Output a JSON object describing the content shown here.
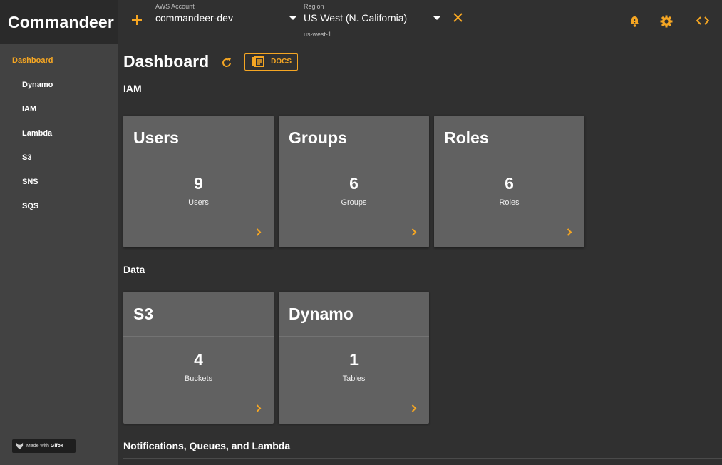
{
  "app": {
    "title": "Commandeer"
  },
  "sidebar": {
    "items": [
      {
        "label": "Dashboard"
      },
      {
        "label": "Dynamo"
      },
      {
        "label": "IAM"
      },
      {
        "label": "Lambda"
      },
      {
        "label": "S3"
      },
      {
        "label": "SNS"
      },
      {
        "label": "SQS"
      }
    ],
    "badge": {
      "prefix": "Made with",
      "brand": "Gifox"
    }
  },
  "header": {
    "account": {
      "label": "AWS Account",
      "value": "commandeer-dev"
    },
    "region": {
      "label": "Region",
      "value": "US West (N. California)",
      "helper": "us-west-1"
    },
    "icons": [
      "plus-icon",
      "close-icon",
      "bell-icon",
      "gear-icon",
      "code-icon"
    ]
  },
  "main": {
    "title": "Dashboard",
    "docs_label": "DOCS",
    "sections": [
      {
        "title": "IAM",
        "cards": [
          {
            "title": "Users",
            "count": "9",
            "unit": "Users"
          },
          {
            "title": "Groups",
            "count": "6",
            "unit": "Groups"
          },
          {
            "title": "Roles",
            "count": "6",
            "unit": "Roles"
          }
        ]
      },
      {
        "title": "Data",
        "cards": [
          {
            "title": "S3",
            "count": "4",
            "unit": "Buckets"
          },
          {
            "title": "Dynamo",
            "count": "1",
            "unit": "Tables"
          }
        ]
      },
      {
        "title": "Notifications, Queues, and Lambda",
        "cards": []
      }
    ]
  },
  "colors": {
    "accent": "#f5a623",
    "background": "#303030",
    "sidebar": "#424242",
    "card": "#616161"
  }
}
